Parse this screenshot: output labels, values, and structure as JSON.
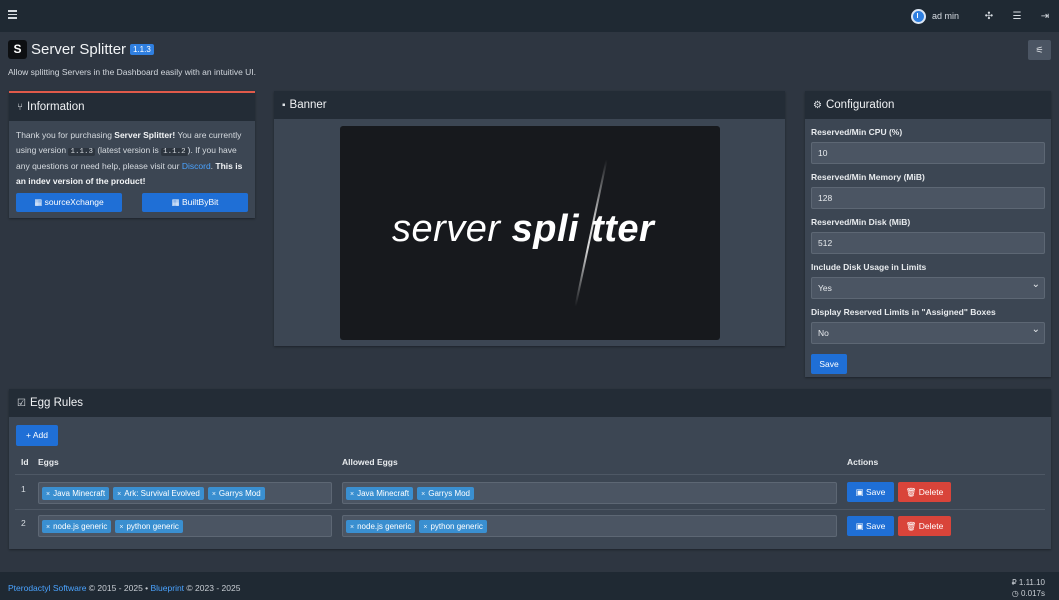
{
  "topbar": {
    "username": "ad min",
    "icons": [
      "menu-icon",
      "puzzle-icon",
      "server-list-icon",
      "logout-icon"
    ]
  },
  "page": {
    "logo_glyph": "S",
    "title": "Server Splitter",
    "version": "1.1.3",
    "subtitle": "Allow splitting Servers in the Dashboard easily with an intuitive UI.",
    "settings_icon": "sliders-icon"
  },
  "information": {
    "title": "Information",
    "text_1": "Thank you for purchasing ",
    "product": "Server Splitter!",
    "text_2": " You are currently using version ",
    "current_version": "1.1.3",
    "text_3": " (latest version is ",
    "latest_version": "1.1.2",
    "text_4": "). If you have any questions or need help, please visit our ",
    "discord": "Discord",
    "text_5": ". ",
    "notice": "This is an indev version of the product!",
    "buttons": [
      {
        "label": "sourceXchange"
      },
      {
        "label": "BuiltByBit"
      }
    ]
  },
  "banner": {
    "title": "Banner",
    "word_1": "server ",
    "word_2": "spli",
    "word_3": "tter"
  },
  "configuration": {
    "title": "Configuration",
    "fields": [
      {
        "label": "Reserved/Min CPU (%)",
        "value": "10"
      },
      {
        "label": "Reserved/Min Memory (MiB)",
        "value": "128"
      },
      {
        "label": "Reserved/Min Disk (MiB)",
        "value": "512"
      },
      {
        "label": "Include Disk Usage in Limits",
        "value": "Yes"
      },
      {
        "label": "Display Reserved Limits in \"Assigned\" Boxes",
        "value": "No"
      }
    ],
    "save_label": "Save"
  },
  "egg_rules": {
    "title": "Egg Rules",
    "add_label": "+ Add",
    "columns": [
      "Id",
      "Eggs",
      "Allowed Eggs",
      "Actions"
    ],
    "rows": [
      {
        "id": "1",
        "eggs": [
          "Java Minecraft",
          "Ark: Survival Evolved",
          "Garrys Mod"
        ],
        "allowed": [
          "Java Minecraft",
          "Garrys Mod"
        ],
        "save": "Save",
        "delete": "Delete"
      },
      {
        "id": "2",
        "eggs": [
          "node.js generic",
          "python generic"
        ],
        "allowed": [
          "node.js generic",
          "python generic"
        ],
        "save": "Save",
        "delete": "Delete"
      }
    ]
  },
  "footer": {
    "pterodactyl": "Pterodactyl Software",
    "copy_1": " © 2015 - 2025 • ",
    "blueprint": "Blueprint",
    "copy_2": " © 2023 - 2025",
    "version": "1.11.10",
    "time": "0.017s"
  },
  "colors": {
    "accent": "#1f6fd6",
    "danger": "#d9443a",
    "tag": "#3a8fd0",
    "info_border": "#e05a4a"
  }
}
